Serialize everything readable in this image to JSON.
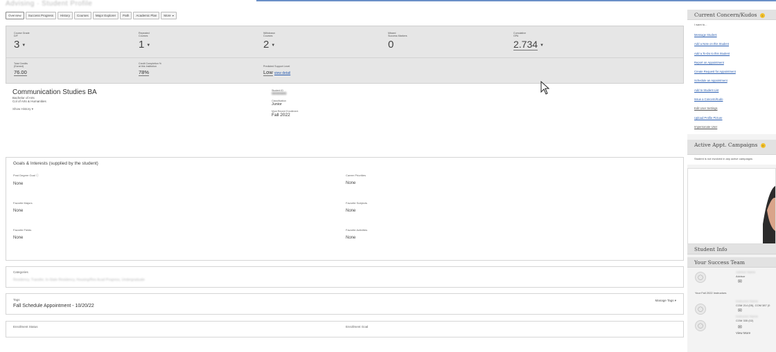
{
  "header": {
    "title": "Advising · Student Profile"
  },
  "tabs": [
    {
      "label": "Overview"
    },
    {
      "label": "Success Progress"
    },
    {
      "label": "History"
    },
    {
      "label": "Courses"
    },
    {
      "label": "Major Explorer"
    },
    {
      "label": "Path"
    },
    {
      "label": "Academic Plan"
    },
    {
      "label": "More"
    }
  ],
  "stats": {
    "course_grade": {
      "label1": "Course Grade",
      "label2": "D/F",
      "value": "3"
    },
    "repeated": {
      "label1": "Repeated",
      "label2": "Courses",
      "value": "1"
    },
    "withdrawn": {
      "label1": "Withdrawn",
      "label2": "Courses",
      "value": "2"
    },
    "missed_success": {
      "label1": "Missed",
      "label2": "Success Markers",
      "value": "0"
    },
    "cumulative_gpa": {
      "label1": "Cumulative",
      "label2": "GPA",
      "value": "2.734"
    },
    "total_credits": {
      "label1": "Total Credits",
      "label2": "(Earned)",
      "value": "76.00"
    },
    "credit_completion": {
      "label1": "Credit Completion %",
      "label2": "at this Institution",
      "value": "78%"
    },
    "predicted_support": {
      "label1": "Predicted Support Level",
      "value": "Low",
      "link": "view detail"
    }
  },
  "program": {
    "name": "Communication Studies BA",
    "degree": "Bachelor of Arts",
    "college": "Col of Arts & Humanities",
    "more_history": "Show History"
  },
  "student_info": {
    "id_label": "Student ID",
    "id_value": "0000000",
    "classification_label": "Classification",
    "classification_value": "Junior",
    "term_label": "Most Recent Enrollment",
    "term_value": "Fall 2022"
  },
  "goals": {
    "title": "Goals & Interests (supplied by the student)",
    "fields": [
      {
        "label": "Post Degree Goal",
        "value": "None"
      },
      {
        "label": "Career Priorities",
        "value": "None"
      },
      {
        "label": "Favorite Majors",
        "value": "None"
      },
      {
        "label": "Favorite Subjects",
        "value": "None"
      },
      {
        "label": "Favorite Fields",
        "value": "None"
      },
      {
        "label": "Favorite Activities",
        "value": "None"
      }
    ]
  },
  "categories": {
    "label": "Categories",
    "value": "Residency, Transfer, In-State Residency, Housing/Res Acad Progress, Undergraduate"
  },
  "tags": {
    "label": "Tags",
    "value": "Fall Schedule Appointment - 10/20/22",
    "manage": "Manage Tags"
  },
  "enrollment": {
    "status_label": "Enrollment Status",
    "goal_label": "Enrollment Goal"
  },
  "sidebar": {
    "concern_title": "Current Concern/Kudos",
    "concern_count": "2",
    "intro": "I want to...",
    "links": [
      "Message Student",
      "Add a Note on this Student",
      "Add a To-Do to this Student",
      "Report on Appointment",
      "Create Request for Appointment",
      "Schedule an Appointment",
      "Add to Student List",
      "Issue a Concern/Kudo",
      "Edit User Settings",
      "Upload Profile Picture",
      "Impersonate User"
    ],
    "campaigns_title": "Active Appt. Campaigns",
    "campaigns_count": "0",
    "campaigns_text": "Student is not involved in any active campaigns",
    "student_info_title": "Student Info",
    "success_team_title": "Your Success Team",
    "advisor_name": "Advisor Name",
    "advisor_role": "Advisor",
    "instructors_label": "Your Fall 2022 Instructors",
    "instructor1_name": "Instructor Name",
    "instructor1_courses": "COM 214 (05), COM 387 (0",
    "instructor2_name": "Instructor Name",
    "instructor2_courses": "COM 335 (02)",
    "view_more": "View More"
  }
}
